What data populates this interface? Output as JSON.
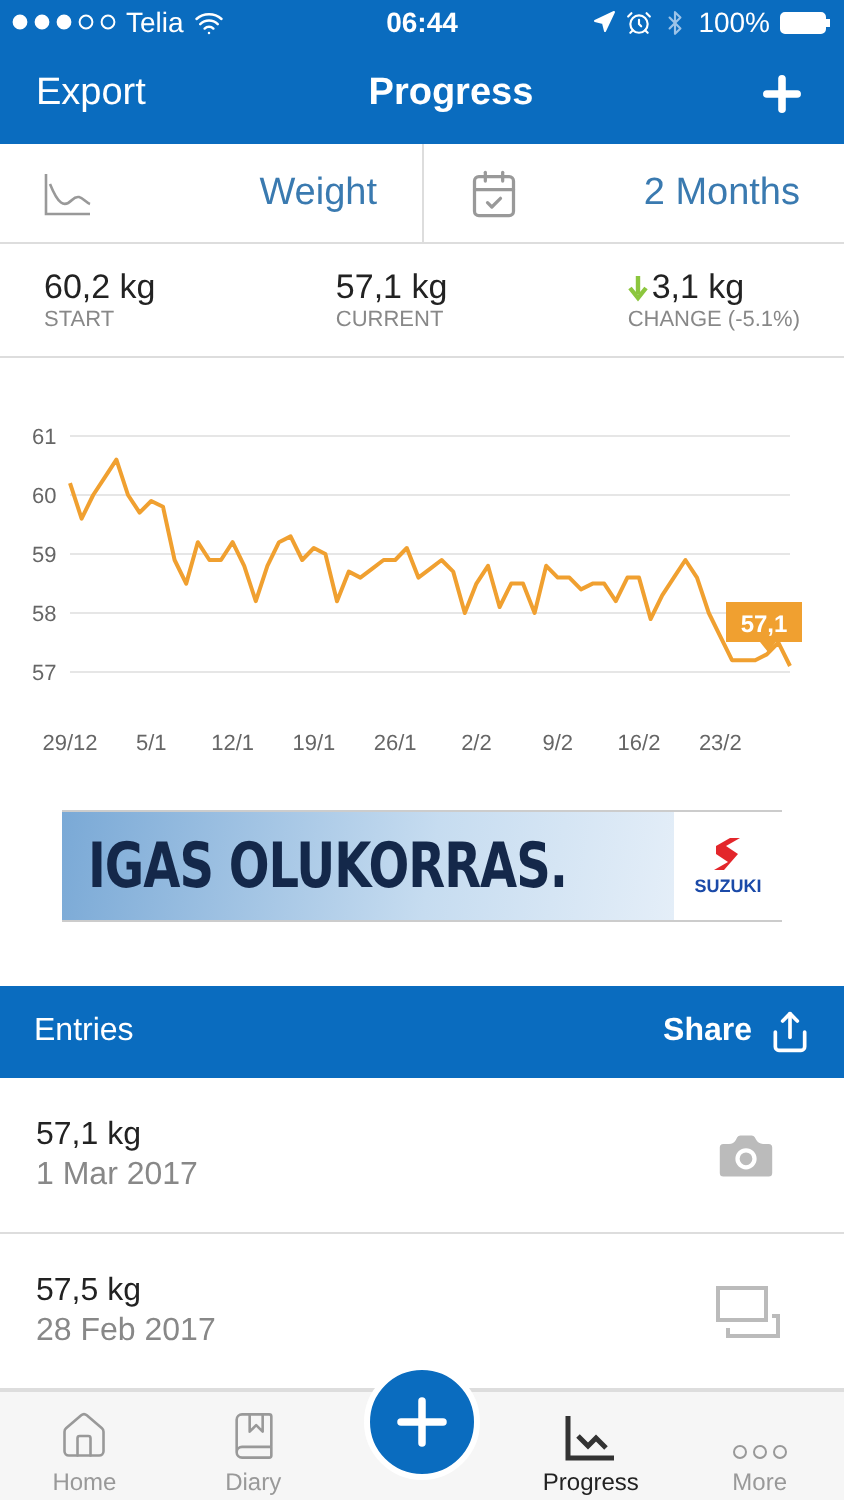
{
  "status_bar": {
    "carrier": "Telia",
    "time": "06:44",
    "battery": "100%"
  },
  "nav": {
    "left": "Export",
    "title": "Progress"
  },
  "selectors": [
    {
      "kind": "metric",
      "label": "Weight"
    },
    {
      "kind": "period",
      "label": "2 Months"
    }
  ],
  "stats": [
    {
      "kind": "plain",
      "value": "60,2 kg",
      "label": "START"
    },
    {
      "kind": "plain",
      "value": "57,1 kg",
      "label": "CURRENT"
    },
    {
      "kind": "change",
      "value": "3,1 kg",
      "label": "CHANGE (-5.1%)"
    }
  ],
  "chart": {
    "chart_data": {
      "type": "line",
      "ylim": [
        57,
        61
      ],
      "yticks": [
        57,
        58,
        59,
        60,
        61
      ],
      "categories": [
        "29/12",
        null,
        null,
        null,
        null,
        null,
        null,
        "5/1",
        null,
        null,
        null,
        null,
        null,
        null,
        "12/1",
        null,
        null,
        null,
        null,
        null,
        null,
        "19/1",
        null,
        null,
        null,
        null,
        null,
        null,
        "26/1",
        null,
        null,
        null,
        null,
        null,
        null,
        "2/2",
        null,
        null,
        null,
        null,
        null,
        null,
        "9/2",
        null,
        null,
        null,
        null,
        null,
        null,
        "16/2",
        null,
        null,
        null,
        null,
        null,
        null,
        "23/2",
        null,
        null,
        null,
        null,
        null,
        null
      ],
      "series": [
        {
          "color": "#f0a030",
          "values": [
            60.2,
            59.6,
            60.0,
            60.3,
            60.6,
            60.0,
            59.7,
            59.9,
            59.8,
            58.9,
            58.5,
            59.2,
            58.9,
            58.9,
            59.2,
            58.8,
            58.2,
            58.8,
            59.2,
            59.3,
            58.9,
            59.1,
            59.0,
            58.2,
            58.7,
            58.6,
            58.75,
            58.9,
            58.9,
            59.1,
            58.6,
            58.75,
            58.9,
            58.7,
            58.0,
            58.5,
            58.8,
            58.1,
            58.5,
            58.5,
            58.0,
            58.8,
            58.6,
            58.6,
            58.4,
            58.5,
            58.5,
            58.2,
            58.6,
            58.6,
            57.9,
            58.3,
            58.6,
            58.9,
            58.6,
            58.0,
            57.6,
            57.2,
            57.2,
            57.2,
            57.3,
            57.5,
            57.1
          ]
        }
      ],
      "grid": true,
      "annotations": [
        {
          "y": 57.1,
          "text": "57,1"
        }
      ]
    }
  },
  "ad": {
    "headline": "IGAS OLUKORRAS.",
    "brand": "SUZUKI"
  },
  "entries": {
    "title": "Entries",
    "share": "Share",
    "rows": [
      {
        "kind": "photo",
        "weight": "57,1 kg",
        "date": "1 Mar 2017"
      },
      {
        "kind": "compare",
        "weight": "57,5 kg",
        "date": "28 Feb 2017"
      }
    ]
  },
  "tab_bar": [
    {
      "kind": "home",
      "label": "Home",
      "selected": false
    },
    {
      "kind": "diary",
      "label": "Diary",
      "selected": false
    },
    {
      "kind": "add"
    },
    {
      "kind": "progress",
      "label": "Progress",
      "selected": true
    },
    {
      "kind": "more",
      "label": "More",
      "selected": false
    }
  ]
}
